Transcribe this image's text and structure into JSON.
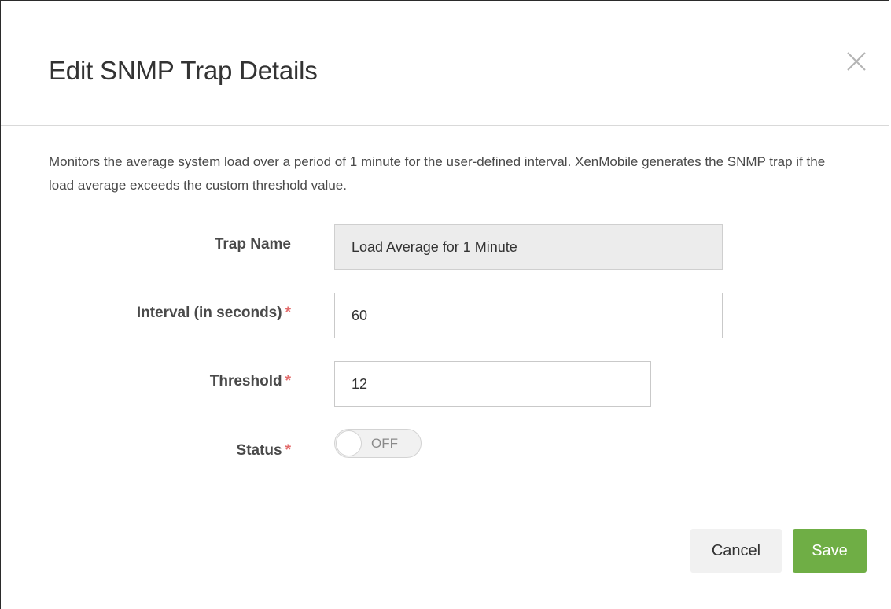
{
  "dialog": {
    "title": "Edit SNMP Trap Details",
    "close_icon": "close-icon",
    "description": "Monitors the average system load over a period of 1 minute for the user-defined interval. XenMobile generates the SNMP trap if the load average exceeds the custom threshold value."
  },
  "form": {
    "trap_name": {
      "label": "Trap Name",
      "value": "Load Average for 1 Minute",
      "readonly": true
    },
    "interval": {
      "label": "Interval (in seconds)",
      "required_marker": "*",
      "value": "60"
    },
    "threshold": {
      "label": "Threshold",
      "required_marker": "*",
      "value": "12"
    },
    "status": {
      "label": "Status",
      "required_marker": "*",
      "toggle_text": "OFF",
      "enabled": false
    }
  },
  "buttons": {
    "cancel_label": "Cancel",
    "save_label": "Save"
  },
  "colors": {
    "save_button": "#6fae45",
    "required_marker": "#e36c6c",
    "readonly_field": "#ececec"
  }
}
